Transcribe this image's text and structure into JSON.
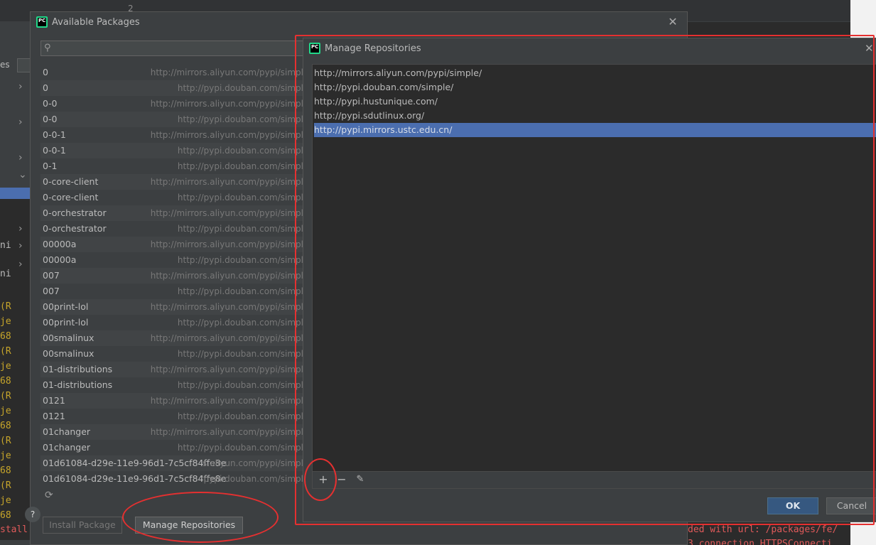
{
  "background": {
    "line_number": "2",
    "code_lines": [
      {
        "text": "ni",
        "color": "white"
      },
      {
        "text": "ni",
        "color": "white"
      },
      {
        "text": "(R",
        "color": "yellow"
      },
      {
        "text": "je",
        "color": "yellow"
      },
      {
        "text": "68",
        "color": "yellow"
      },
      {
        "text": "(R",
        "color": "yellow"
      },
      {
        "text": "je",
        "color": "yellow"
      },
      {
        "text": "68",
        "color": "yellow"
      },
      {
        "text": "(R",
        "color": "yellow"
      },
      {
        "text": "je",
        "color": "yellow"
      },
      {
        "text": "68",
        "color": "yellow"
      },
      {
        "text": "(R",
        "color": "yellow"
      },
      {
        "text": "je",
        "color": "yellow"
      },
      {
        "text": "68",
        "color": "yellow"
      },
      {
        "text": "(R",
        "color": "yellow"
      },
      {
        "text": "je",
        "color": "yellow"
      },
      {
        "text": "68",
        "color": "yellow"
      }
    ],
    "console_left": "stall p",
    "console_right": "ded with url: /packages/fe/",
    "console_right2": "3 connection HTTPSConnecti",
    "left_partial_label": "es"
  },
  "available_packages": {
    "title": "Available Packages",
    "search_placeholder": "",
    "packages": [
      {
        "name": "0",
        "repo": "http://mirrors.aliyun.com/pypi/simpl"
      },
      {
        "name": "0",
        "repo": "http://pypi.douban.com/simpl"
      },
      {
        "name": "0-0",
        "repo": "http://mirrors.aliyun.com/pypi/simpl"
      },
      {
        "name": "0-0",
        "repo": "http://pypi.douban.com/simpl"
      },
      {
        "name": "0-0-1",
        "repo": "http://mirrors.aliyun.com/pypi/simpl"
      },
      {
        "name": "0-0-1",
        "repo": "http://pypi.douban.com/simpl"
      },
      {
        "name": "0-1",
        "repo": "http://pypi.douban.com/simpl"
      },
      {
        "name": "0-core-client",
        "repo": "http://mirrors.aliyun.com/pypi/simpl"
      },
      {
        "name": "0-core-client",
        "repo": "http://pypi.douban.com/simpl"
      },
      {
        "name": "0-orchestrator",
        "repo": "http://mirrors.aliyun.com/pypi/simpl"
      },
      {
        "name": "0-orchestrator",
        "repo": "http://pypi.douban.com/simpl"
      },
      {
        "name": "00000a",
        "repo": "http://mirrors.aliyun.com/pypi/simpl"
      },
      {
        "name": "00000a",
        "repo": "http://pypi.douban.com/simpl"
      },
      {
        "name": "007",
        "repo": "http://mirrors.aliyun.com/pypi/simpl"
      },
      {
        "name": "007",
        "repo": "http://pypi.douban.com/simpl"
      },
      {
        "name": "00print-lol",
        "repo": "http://mirrors.aliyun.com/pypi/simpl"
      },
      {
        "name": "00print-lol",
        "repo": "http://pypi.douban.com/simpl"
      },
      {
        "name": "00smalinux",
        "repo": "http://mirrors.aliyun.com/pypi/simpl"
      },
      {
        "name": "00smalinux",
        "repo": "http://pypi.douban.com/simpl"
      },
      {
        "name": "01-distributions",
        "repo": "http://mirrors.aliyun.com/pypi/simpl"
      },
      {
        "name": "01-distributions",
        "repo": "http://pypi.douban.com/simpl"
      },
      {
        "name": "0121",
        "repo": "http://mirrors.aliyun.com/pypi/simpl"
      },
      {
        "name": "0121",
        "repo": "http://pypi.douban.com/simpl"
      },
      {
        "name": "01changer",
        "repo": "http://mirrors.aliyun.com/pypi/simpl"
      },
      {
        "name": "01changer",
        "repo": "http://pypi.douban.com/simpl"
      },
      {
        "name": "01d61084-d29e-11e9-96d1-7c5cf84ffe8e",
        "repo": "s.aliyun.com/pypi/simpl"
      },
      {
        "name": "01d61084-d29e-11e9-96d1-7c5cf84ffe8e",
        "repo": "'pypi.douban.com/simpl"
      }
    ],
    "install_label": "Install Package",
    "manage_label": "Manage Repositories",
    "help_label": "?"
  },
  "manage_repositories": {
    "title": "Manage Repositories",
    "repositories": [
      "http://mirrors.aliyun.com/pypi/simple/",
      "http://pypi.douban.com/simple/",
      "http://pypi.hustunique.com/",
      "http://pypi.sdutlinux.org/",
      "http://pypi.mirrors.ustc.edu.cn/"
    ],
    "selected_index": 4,
    "ok_label": "OK",
    "cancel_label": "Cancel"
  },
  "icons": {
    "close": "close-icon",
    "search": "search-icon",
    "refresh": "refresh-icon",
    "add": "add-icon",
    "remove": "remove-icon",
    "edit": "edit-icon"
  },
  "colors": {
    "selection": "#4b6eaf",
    "ok_button": "#365880",
    "annotation_red": "#e53030"
  }
}
